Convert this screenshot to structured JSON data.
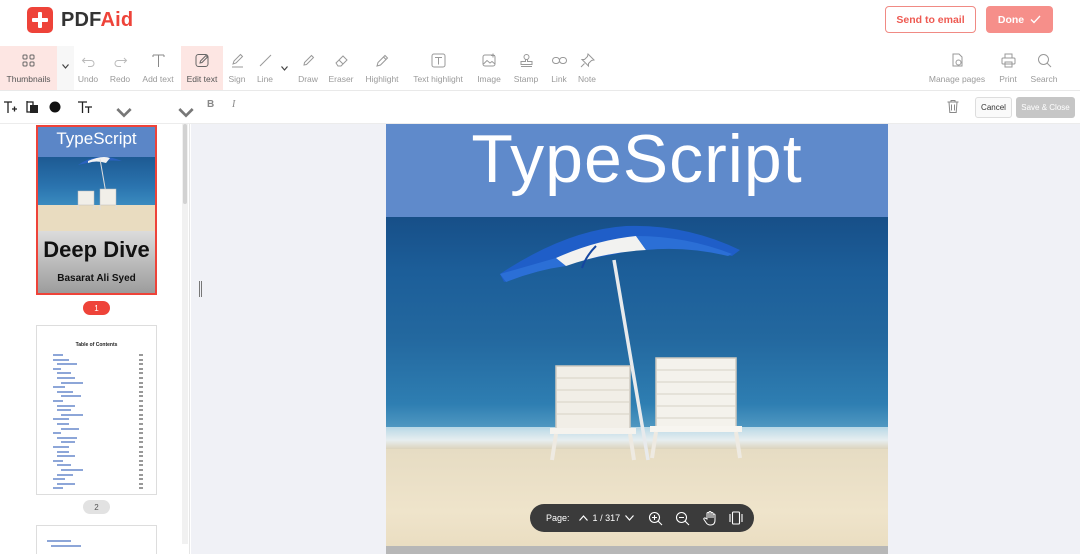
{
  "app": {
    "logo_prefix": "PDF",
    "logo_accent": "Aid",
    "brand_color": "#ee4339"
  },
  "header": {
    "send_email_label": "Send to email",
    "done_label": "Done"
  },
  "toolbar": {
    "items": [
      {
        "label": "Thumbnails",
        "icon": "thumbnails-icon",
        "state": "open"
      },
      {
        "label": "Undo",
        "icon": "undo-icon",
        "state": "disabled"
      },
      {
        "label": "Redo",
        "icon": "redo-icon",
        "state": "disabled"
      },
      {
        "label": "Add text",
        "icon": "add-text-icon",
        "state": "enabled"
      },
      {
        "label": "Edit text",
        "icon": "edit-text-icon",
        "state": "active"
      },
      {
        "label": "Sign",
        "icon": "sign-icon",
        "state": "enabled"
      },
      {
        "label": "Line",
        "icon": "line-icon",
        "state": "enabled"
      },
      {
        "label": "Draw",
        "icon": "draw-icon",
        "state": "enabled"
      },
      {
        "label": "Eraser",
        "icon": "eraser-icon",
        "state": "enabled"
      },
      {
        "label": "Highlight",
        "icon": "highlight-icon",
        "state": "enabled"
      },
      {
        "label": "Text highlight",
        "icon": "text-highlight-icon",
        "state": "enabled"
      },
      {
        "label": "Image",
        "icon": "image-icon",
        "state": "enabled"
      },
      {
        "label": "Stamp",
        "icon": "stamp-icon",
        "state": "enabled"
      },
      {
        "label": "Link",
        "icon": "link-icon",
        "state": "enabled"
      },
      {
        "label": "Note",
        "icon": "note-icon",
        "state": "enabled"
      },
      {
        "label": "Manage pages",
        "icon": "manage-pages-icon",
        "state": "enabled"
      },
      {
        "label": "Print",
        "icon": "print-icon",
        "state": "enabled"
      },
      {
        "label": "Search",
        "icon": "search-icon",
        "state": "enabled"
      }
    ]
  },
  "format_bar": {
    "font_family_value": "",
    "font_size_value": "",
    "bold_label": "B",
    "italic_label": "I",
    "cancel_label": "Cancel",
    "save_close_label": "Save & Close"
  },
  "thumbnails": {
    "page1": {
      "title": "TypeScript",
      "subtitle": "Deep Dive",
      "author": "Basarat Ali Syed",
      "page_number": "1"
    },
    "page2": {
      "title": "Table of Contents",
      "page_number": "2"
    }
  },
  "document": {
    "page_title": "TypeScript"
  },
  "page_nav": {
    "label": "Page:",
    "current_page": "1",
    "separator": "/",
    "total_pages": "317"
  }
}
